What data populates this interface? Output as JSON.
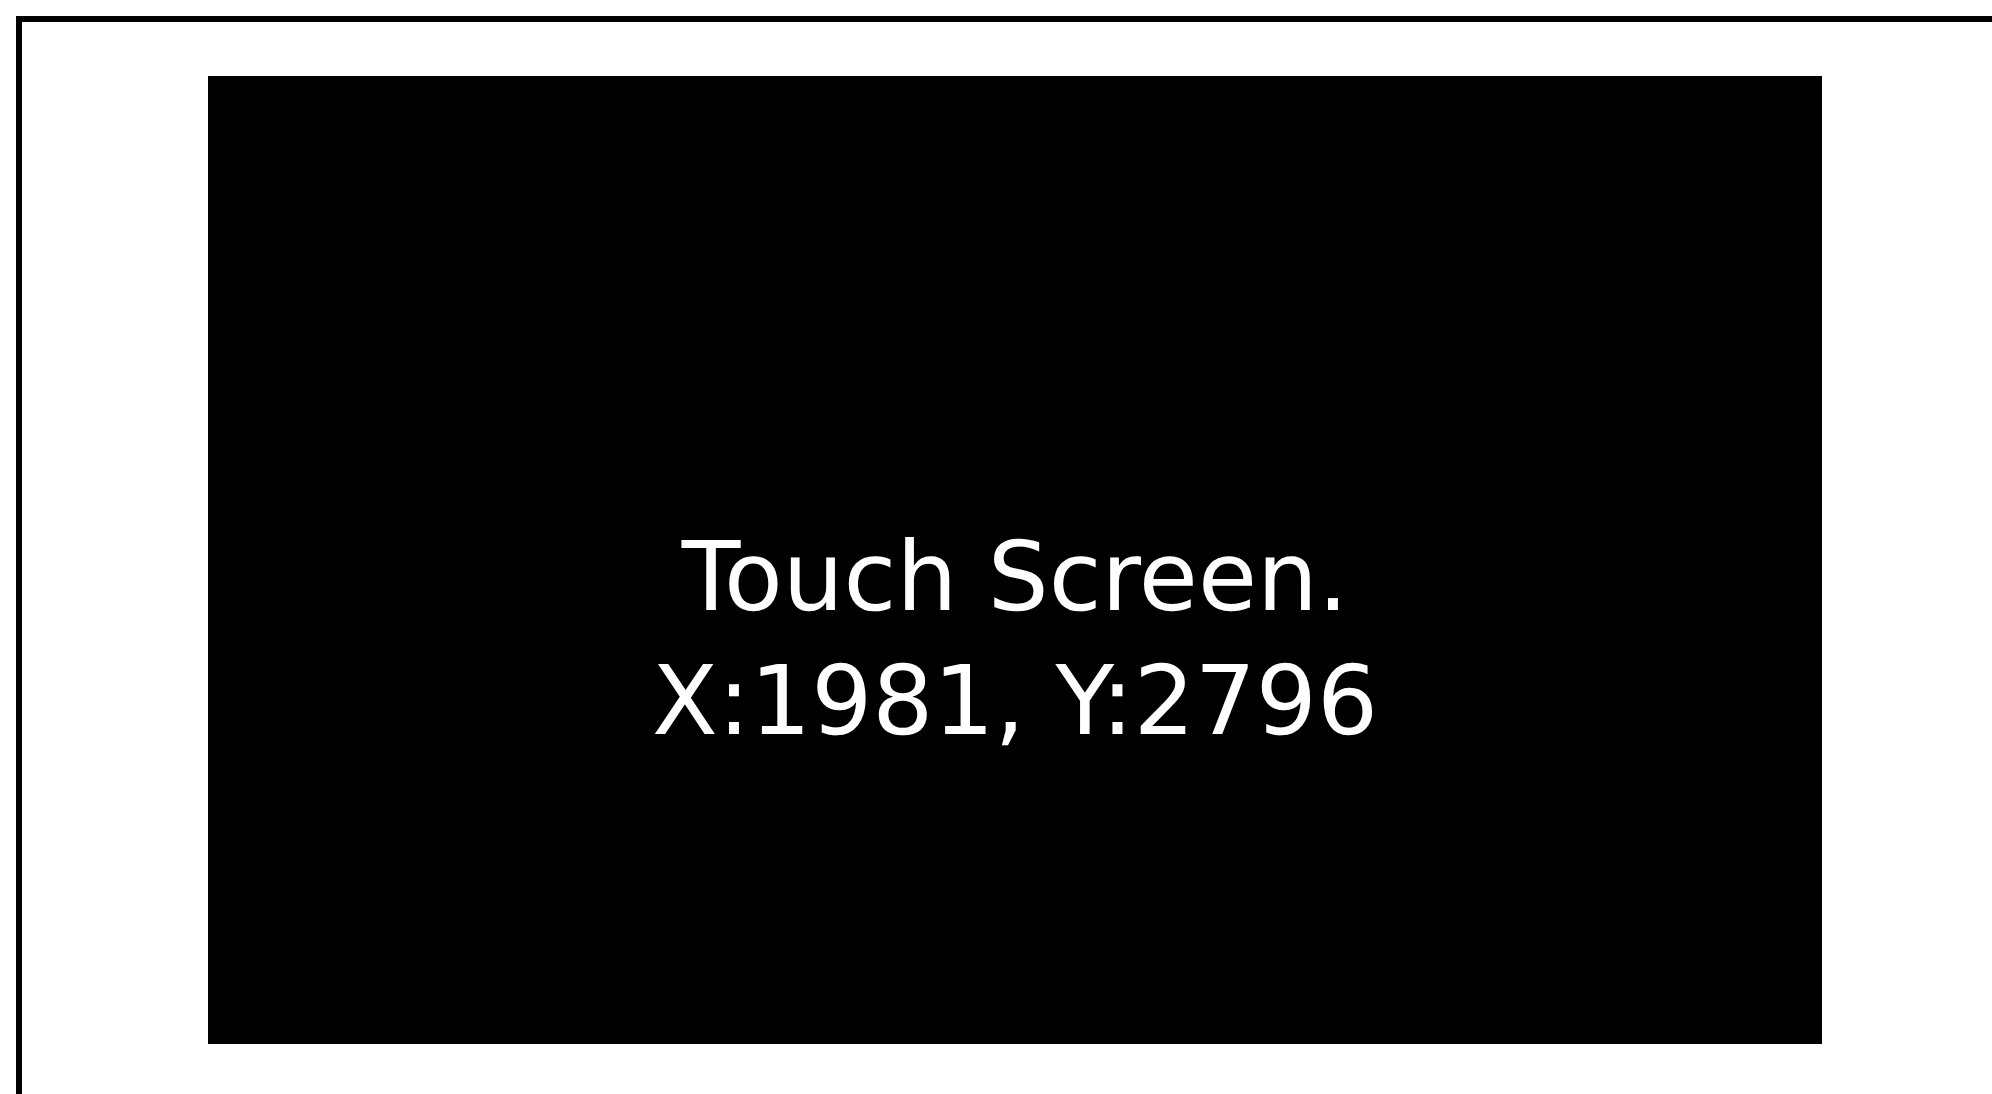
{
  "display": {
    "lines": [
      "Touch Screen.",
      "X:1981, Y:2796"
    ]
  }
}
